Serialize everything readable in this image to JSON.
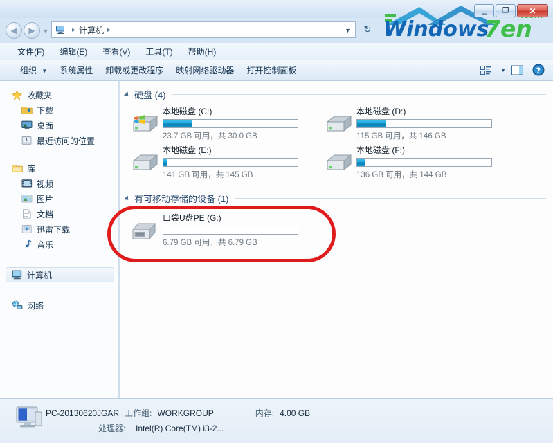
{
  "window": {
    "title_buttons": {
      "minimize": "–",
      "maximize": "❐",
      "close": "✕"
    }
  },
  "watermark": {
    "text_main": "Windows",
    "text_accent": "7en",
    "text_tld": ".com"
  },
  "address": {
    "crumb_root_icon": "computer-icon",
    "crumb1": "计算机",
    "sep": "▸",
    "dropdown_icon": "▼",
    "refresh_icon": "↻"
  },
  "menubar": {
    "items": [
      {
        "label": "文件(F)",
        "name": "menu-file"
      },
      {
        "label": "编辑(E)",
        "name": "menu-edit"
      },
      {
        "label": "查看(V)",
        "name": "menu-view"
      },
      {
        "label": "工具(T)",
        "name": "menu-tools"
      },
      {
        "label": "帮助(H)",
        "name": "menu-help"
      }
    ]
  },
  "toolbar": {
    "organize": "组织",
    "organize_caret": "▼",
    "system_properties": "系统属性",
    "uninstall_change": "卸载或更改程序",
    "map_network_drive": "映射网络驱动器",
    "open_control_panel": "打开控制面板",
    "view_caret": "▼"
  },
  "sidebar": {
    "favorites": {
      "label": "收藏夹",
      "items": [
        {
          "label": "下载",
          "icon": "downloads-icon"
        },
        {
          "label": "桌面",
          "icon": "desktop-icon"
        },
        {
          "label": "最近访问的位置",
          "icon": "recent-places-icon"
        }
      ]
    },
    "libraries": {
      "label": "库",
      "items": [
        {
          "label": "视频",
          "icon": "videos-icon"
        },
        {
          "label": "图片",
          "icon": "pictures-icon"
        },
        {
          "label": "文档",
          "icon": "documents-icon"
        },
        {
          "label": "迅雷下载",
          "icon": "thunder-download-icon"
        },
        {
          "label": "音乐",
          "icon": "music-icon"
        }
      ]
    },
    "computer": {
      "label": "计算机",
      "icon": "computer-icon",
      "selected": true
    },
    "network": {
      "label": "网络",
      "icon": "network-icon"
    }
  },
  "content": {
    "groups": [
      {
        "title": "硬盘 (4)",
        "name": "group-hard-disks",
        "tiles": [
          {
            "name": "本地磁盘 (C:)",
            "capacity": "23.7 GB 可用，共 30.0 GB",
            "used_percent": 21,
            "icon": "system-drive-icon"
          },
          {
            "name": "本地磁盘 (D:)",
            "capacity": "115 GB 可用，共 146 GB",
            "used_percent": 21,
            "icon": "drive-icon"
          },
          {
            "name": "本地磁盘 (E:)",
            "capacity": "141 GB 可用，共 145 GB",
            "used_percent": 3,
            "icon": "drive-icon"
          },
          {
            "name": "本地磁盘 (F:)",
            "capacity": "136 GB 可用，共 144 GB",
            "used_percent": 6,
            "icon": "drive-icon"
          }
        ]
      },
      {
        "title": "有可移动存储的设备 (1)",
        "name": "group-removable-devices",
        "tiles": [
          {
            "name": "口袋U盘PE (G:)",
            "capacity": "6.79 GB 可用，共 6.79 GB",
            "used_percent": 0,
            "icon": "usb-drive-icon"
          }
        ]
      }
    ],
    "annotation_color": "#e01b1b"
  },
  "statusbar": {
    "pc_name": "PC-20130620JGAR",
    "workgroup_key": "工作组:",
    "workgroup_value": "WORKGROUP",
    "memory_key": "内存:",
    "memory_value": "4.00 GB",
    "cpu_key": "处理器:",
    "cpu_value": "Intel(R) Core(TM) i3-2...",
    "icon": "computer-icon"
  }
}
